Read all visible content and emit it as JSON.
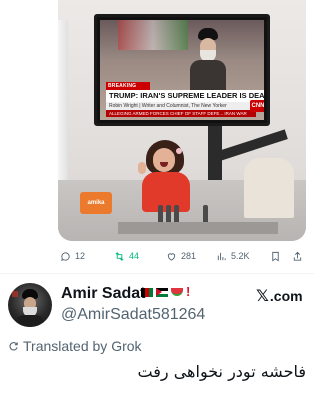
{
  "tv": {
    "breaking_label": "BREAKING NEWS",
    "headline": "TRUMP: IRAN'S SUPREME LEADER IS DEAD",
    "byline": "Robin Wright | Writer and Columnist, The New Yorker",
    "ticker": "ALLEGING ARMED FORCES CHIEF OF STAFF DEFE... IRAN WAR",
    "network": "CNN",
    "bag_label": "amika"
  },
  "actions": {
    "reply_count": "12",
    "retweet_count": "44",
    "like_count": "281",
    "views_count": "5.2K"
  },
  "colors": {
    "retweet_active": "#00ba7c",
    "muted": "#536471",
    "text": "#0f1419"
  },
  "author": {
    "name": "Amir Sadat",
    "handle": "@AmirSadat581264",
    "emojis": [
      "flag-afghanistan",
      "flag-palestine",
      "watermelon",
      "red-exclamation"
    ]
  },
  "brand": {
    "label": ".com"
  },
  "translation": {
    "label": "Translated by Grok",
    "text": "فاحشه تودر نخواهی رفت"
  }
}
